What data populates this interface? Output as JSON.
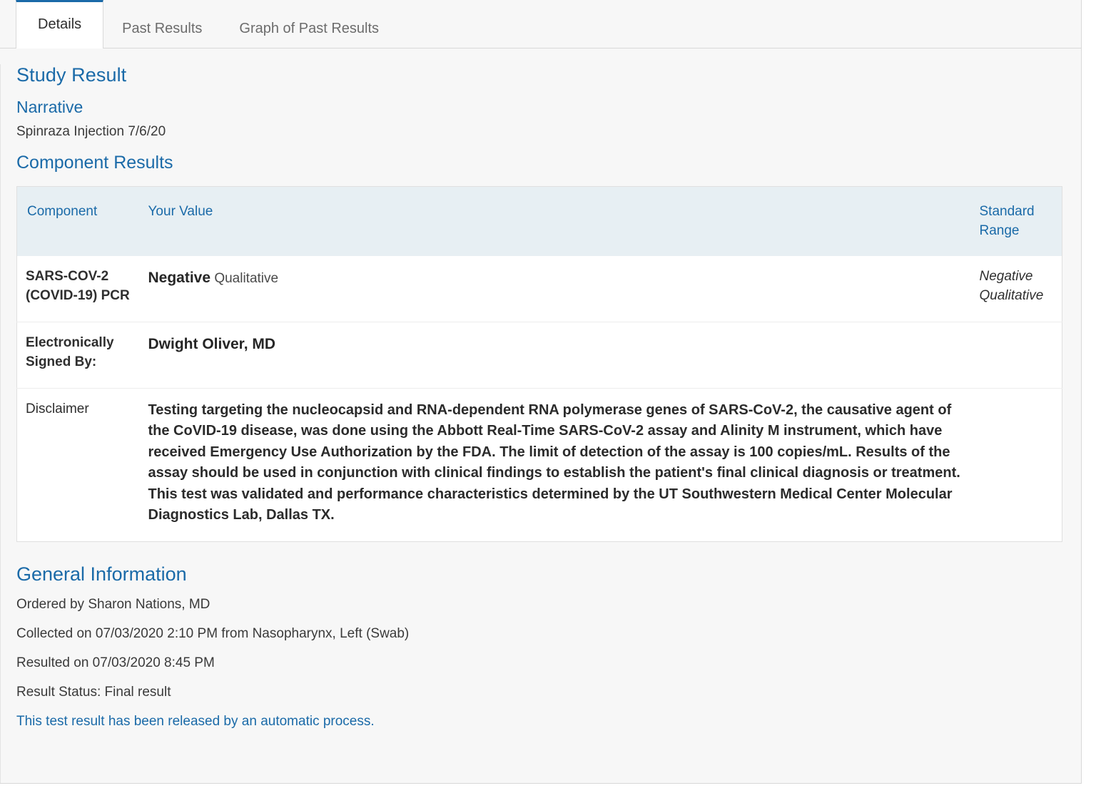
{
  "tabs": [
    {
      "label": "Details",
      "active": true
    },
    {
      "label": "Past Results",
      "active": false
    },
    {
      "label": "Graph of Past Results",
      "active": false
    }
  ],
  "study_result": {
    "title": "Study Result",
    "narrative_heading": "Narrative",
    "narrative_text": "Spinraza Injection 7/6/20",
    "component_results_heading": "Component Results"
  },
  "table": {
    "headers": {
      "component": "Component",
      "your_value": "Your Value",
      "standard_range": "Standard Range"
    },
    "rows": [
      {
        "component": "SARS-COV-2 (COVID-19) PCR",
        "value_main": "Negative",
        "value_unit": "Qualitative",
        "standard_range": "Negative Qualitative"
      },
      {
        "component": "Electronically Signed By:",
        "value_main": "Dwight Oliver, MD",
        "value_unit": "",
        "standard_range": ""
      },
      {
        "component": "Disclaimer",
        "value_main": "Testing targeting the nucleocapsid and RNA-dependent RNA polymerase genes of SARS-CoV-2, the causative agent of the CoVID-19 disease, was done using the Abbott Real-Time SARS-CoV-2 assay and Alinity M instrument, which have received Emergency Use Authorization by the FDA. The limit of detection of the assay is 100 copies/mL. Results of the assay should be used in conjunction with clinical findings to establish the patient's final clinical diagnosis or treatment. This test was validated and performance characteristics determined by the UT Southwestern Medical Center Molecular Diagnostics Lab, Dallas TX.",
        "value_unit": "",
        "standard_range": ""
      }
    ]
  },
  "general_information": {
    "title": "General Information",
    "ordered_by": "Ordered by Sharon Nations, MD",
    "collected_on": "Collected on 07/03/2020 2:10 PM from Nasopharynx, Left (Swab)",
    "resulted_on": "Resulted on 07/03/2020 8:45 PM",
    "result_status": "Result Status: Final result",
    "release_note": "This test result has been released by an automatic process."
  },
  "colors": {
    "accent_blue": "#1a6aa8",
    "tab_active_border": "#1a6aa8",
    "table_header_bg": "#e7eff3",
    "page_bg": "#f7f7f7"
  }
}
